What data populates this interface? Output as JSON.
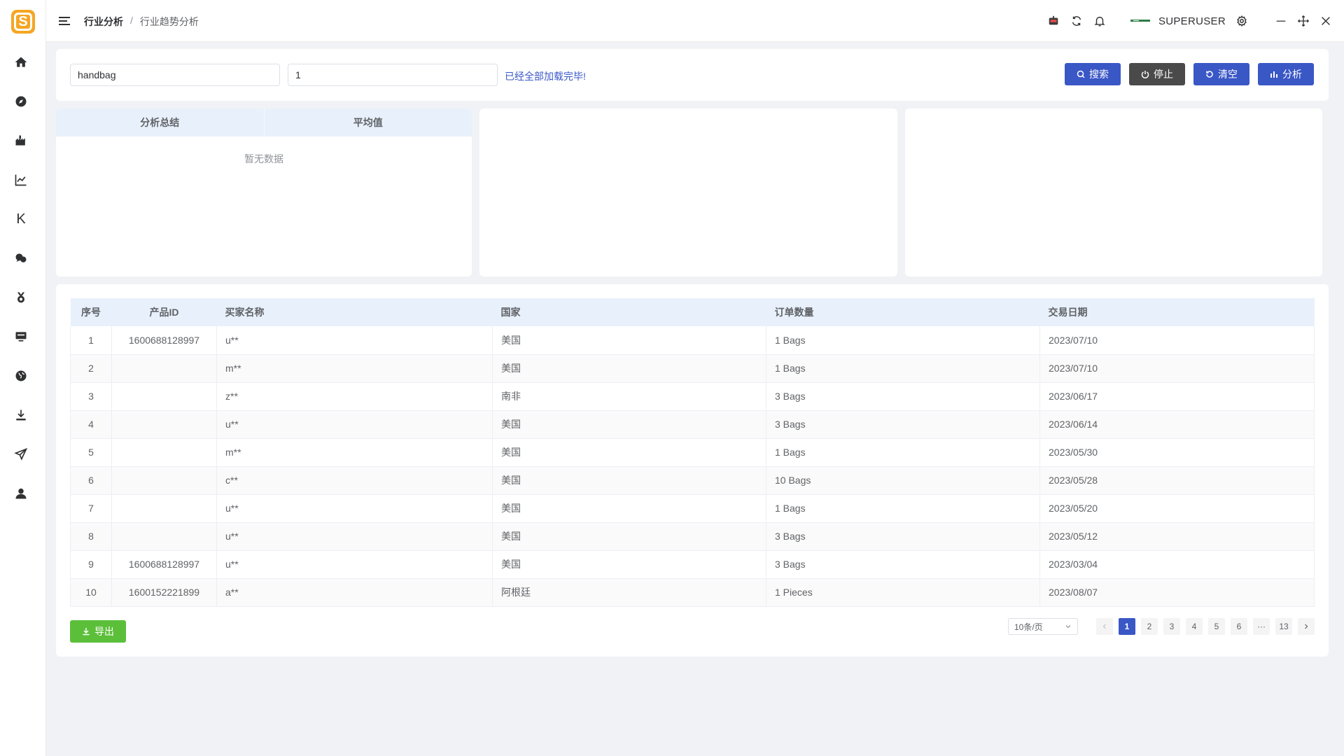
{
  "app": {
    "logo_letter": "S",
    "colors": {
      "logo": "#f5a623",
      "primary": "#3a57c6",
      "stop": "#4a4a4a",
      "export": "#5cbf3a",
      "table_header_bg": "#e8f1fb"
    }
  },
  "sidebar": {
    "items": [
      {
        "icon": "home-icon"
      },
      {
        "icon": "compass-icon"
      },
      {
        "icon": "factory-icon"
      },
      {
        "icon": "line-chart-icon"
      },
      {
        "icon": "k-letter-icon",
        "label": "K"
      },
      {
        "icon": "chat-icon"
      },
      {
        "icon": "medal-icon"
      },
      {
        "icon": "monitor-icon"
      },
      {
        "icon": "globe-icon"
      },
      {
        "icon": "download-icon"
      },
      {
        "icon": "send-icon"
      },
      {
        "icon": "user-icon"
      }
    ]
  },
  "header": {
    "breadcrumb": [
      "行业分析",
      "行业趋势分析"
    ],
    "separator": "/",
    "username": "SUPERUSER"
  },
  "search": {
    "keyword_value": "handbag",
    "page_value": "1",
    "status_message": "已经全部加载完毕!",
    "buttons": {
      "search": "搜索",
      "stop": "停止",
      "clear": "清空",
      "analyze": "分析"
    }
  },
  "summary": {
    "columns": [
      "分析总结",
      "平均值"
    ],
    "empty_text": "暂无数据"
  },
  "table": {
    "headers": [
      "序号",
      "产品ID",
      "买家名称",
      "国家",
      "订单数量",
      "交易日期"
    ],
    "rows": [
      [
        "1",
        "1600688128997",
        "u**",
        "美国",
        "1 Bags",
        "2023/07/10"
      ],
      [
        "2",
        "",
        "m**",
        "美国",
        "1 Bags",
        "2023/07/10"
      ],
      [
        "3",
        "",
        "z**",
        "南非",
        "3 Bags",
        "2023/06/17"
      ],
      [
        "4",
        "",
        "u**",
        "美国",
        "3 Bags",
        "2023/06/14"
      ],
      [
        "5",
        "",
        "m**",
        "美国",
        "1 Bags",
        "2023/05/30"
      ],
      [
        "6",
        "",
        "c**",
        "美国",
        "10 Bags",
        "2023/05/28"
      ],
      [
        "7",
        "",
        "u**",
        "美国",
        "1 Bags",
        "2023/05/20"
      ],
      [
        "8",
        "",
        "u**",
        "美国",
        "3 Bags",
        "2023/05/12"
      ],
      [
        "9",
        "1600688128997",
        "u**",
        "美国",
        "3 Bags",
        "2023/03/04"
      ],
      [
        "10",
        "1600152221899",
        "a**",
        "阿根廷",
        "1 Pieces",
        "2023/08/07"
      ]
    ]
  },
  "footer": {
    "export_label": "导出",
    "page_size": "10条/页",
    "pages": [
      "1",
      "2",
      "3",
      "4",
      "5",
      "6"
    ],
    "ellipsis": "···",
    "last_page": "13",
    "current_page": "1"
  }
}
